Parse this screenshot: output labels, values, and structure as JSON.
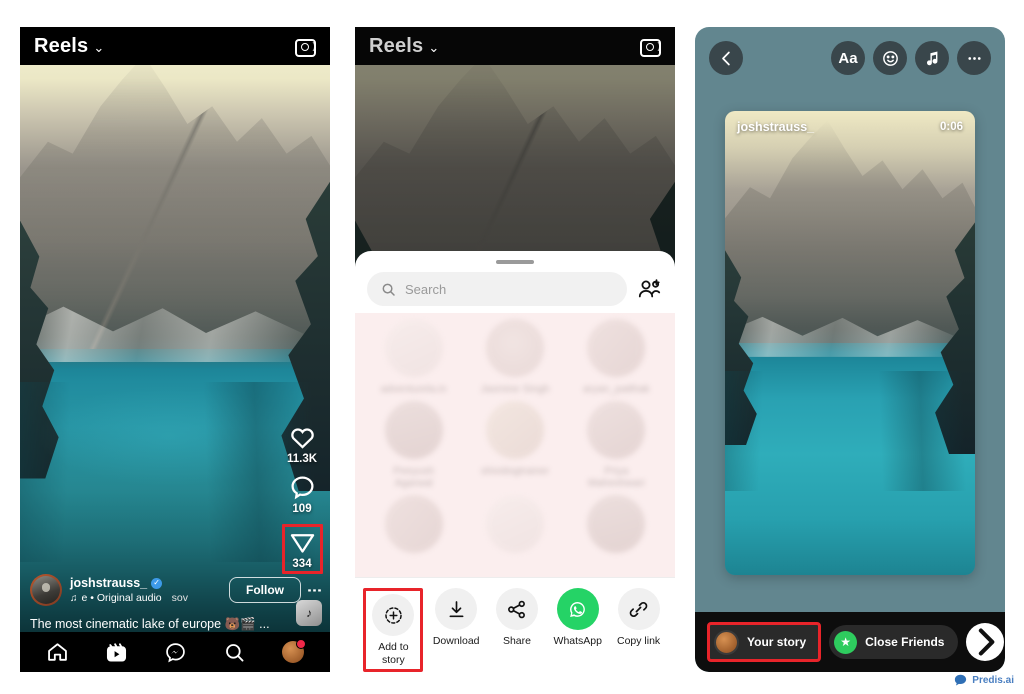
{
  "panel1": {
    "header": {
      "title": "Reels",
      "chevron": "chevron-down-icon",
      "camera": "camera-icon"
    },
    "engagement": [
      {
        "icon": "heart-icon",
        "count": "11.3K",
        "highlighted": false
      },
      {
        "icon": "comment-icon",
        "count": "109",
        "highlighted": false
      },
      {
        "icon": "share-icon",
        "count": "334",
        "highlighted": true
      }
    ],
    "post": {
      "username": "joshstrauss_",
      "verified_badge": "verified-icon",
      "audio": "e • Original audio",
      "audio_extra": "sov",
      "follow_label": "Follow",
      "more_icon": "kebab-menu-icon",
      "caption": "The most cinematic lake of europe 🐻🎬 ...",
      "audio_chip": "audio-cover-icon"
    },
    "tabbar": [
      {
        "icon": "home-icon",
        "name": "home"
      },
      {
        "icon": "reels-icon",
        "name": "reels"
      },
      {
        "icon": "messenger-icon",
        "name": "messenger"
      },
      {
        "icon": "search-icon",
        "name": "search"
      },
      {
        "icon": "profile-avatar",
        "name": "profile"
      }
    ]
  },
  "panel2": {
    "header": {
      "title": "Reels",
      "camera": "camera-icon"
    },
    "sheet": {
      "grabber": "drag-handle",
      "search": {
        "placeholder": "Search",
        "icon": "search-icon"
      },
      "add_people_icon": "add-person-icon",
      "contacts": [
        {
          "name": "adventurela.in"
        },
        {
          "name": "Jasmine Singh"
        },
        {
          "name": "aryan_patthak"
        },
        {
          "name": "Peeyush Agarwal"
        },
        {
          "name": "shividogtrainer"
        },
        {
          "name": "Priya Maheshwari"
        }
      ],
      "actions": [
        {
          "label": "Add to story",
          "icon": "add-to-story-icon",
          "highlighted": true,
          "green": false
        },
        {
          "label": "Download",
          "icon": "download-icon",
          "highlighted": false,
          "green": false
        },
        {
          "label": "Share",
          "icon": "share-nodes-icon",
          "highlighted": false,
          "green": false
        },
        {
          "label": "WhatsApp",
          "icon": "whatsapp-icon",
          "highlighted": false,
          "green": true
        },
        {
          "label": "Copy link",
          "icon": "link-icon",
          "highlighted": false,
          "green": false
        }
      ]
    }
  },
  "panel3": {
    "toolbar": {
      "back": "back-arrow-icon",
      "text_tool": "Aa",
      "sticker": "sticker-icon",
      "music": "music-note-icon",
      "more": "more-options-icon"
    },
    "card": {
      "username": "joshstrauss_",
      "duration": "0:06"
    },
    "bottom": {
      "your_story_label": "Your story",
      "close_friends_label": "Close Friends",
      "next_icon": "chevron-right-icon"
    }
  },
  "watermark": {
    "text": "Predis.ai",
    "logo": "predis-logo-icon"
  },
  "colors": {
    "highlight_red": "#e8242a",
    "whatsapp_green": "#25D366",
    "close_friends_green": "#2ecc5e",
    "verified_blue": "#3d9ae8",
    "notification_red": "#f02849",
    "story_bg": "#62868f"
  }
}
